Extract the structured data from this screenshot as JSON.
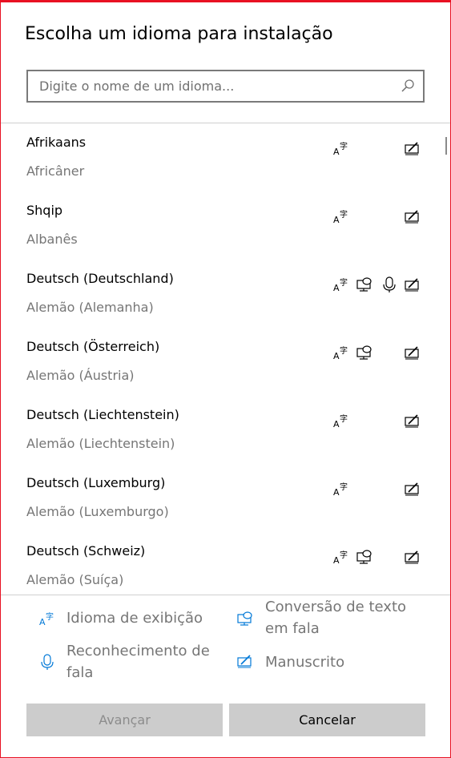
{
  "dialog": {
    "title": "Escolha um idioma para instalação"
  },
  "search": {
    "placeholder": "Digite o nome de um idioma...",
    "value": "",
    "icon": "search-icon"
  },
  "languages": [
    {
      "native": "Afrikaans",
      "translated": "Africâner",
      "features": [
        "display",
        "handwriting"
      ]
    },
    {
      "native": "Shqip",
      "translated": "Albanês",
      "features": [
        "display",
        "handwriting"
      ]
    },
    {
      "native": "Deutsch (Deutschland)",
      "translated": "Alemão (Alemanha)",
      "features": [
        "display",
        "text-to-speech",
        "speech",
        "handwriting"
      ]
    },
    {
      "native": "Deutsch (Österreich)",
      "translated": "Alemão (Áustria)",
      "features": [
        "display",
        "text-to-speech",
        "handwriting"
      ]
    },
    {
      "native": "Deutsch (Liechtenstein)",
      "translated": "Alemão (Liechtenstein)",
      "features": [
        "display",
        "handwriting"
      ]
    },
    {
      "native": "Deutsch (Luxemburg)",
      "translated": "Alemão (Luxemburgo)",
      "features": [
        "display",
        "handwriting"
      ]
    },
    {
      "native": "Deutsch (Schweiz)",
      "translated": "Alemão (Suíça)",
      "features": [
        "display",
        "text-to-speech",
        "handwriting"
      ]
    }
  ],
  "legend": {
    "display_language": "Idioma de exibição",
    "text_to_speech_line1": "Conversão de texto",
    "text_to_speech_line2": "em fala",
    "speech_recognition_line1": "Reconhecimento de",
    "speech_recognition_line2": "fala",
    "handwriting": "Manuscrito"
  },
  "buttons": {
    "next": "Avançar",
    "cancel": "Cancelar"
  },
  "colors": {
    "accent": "#0078d7",
    "window_border": "#e81123",
    "button_bg": "#cccccc"
  }
}
